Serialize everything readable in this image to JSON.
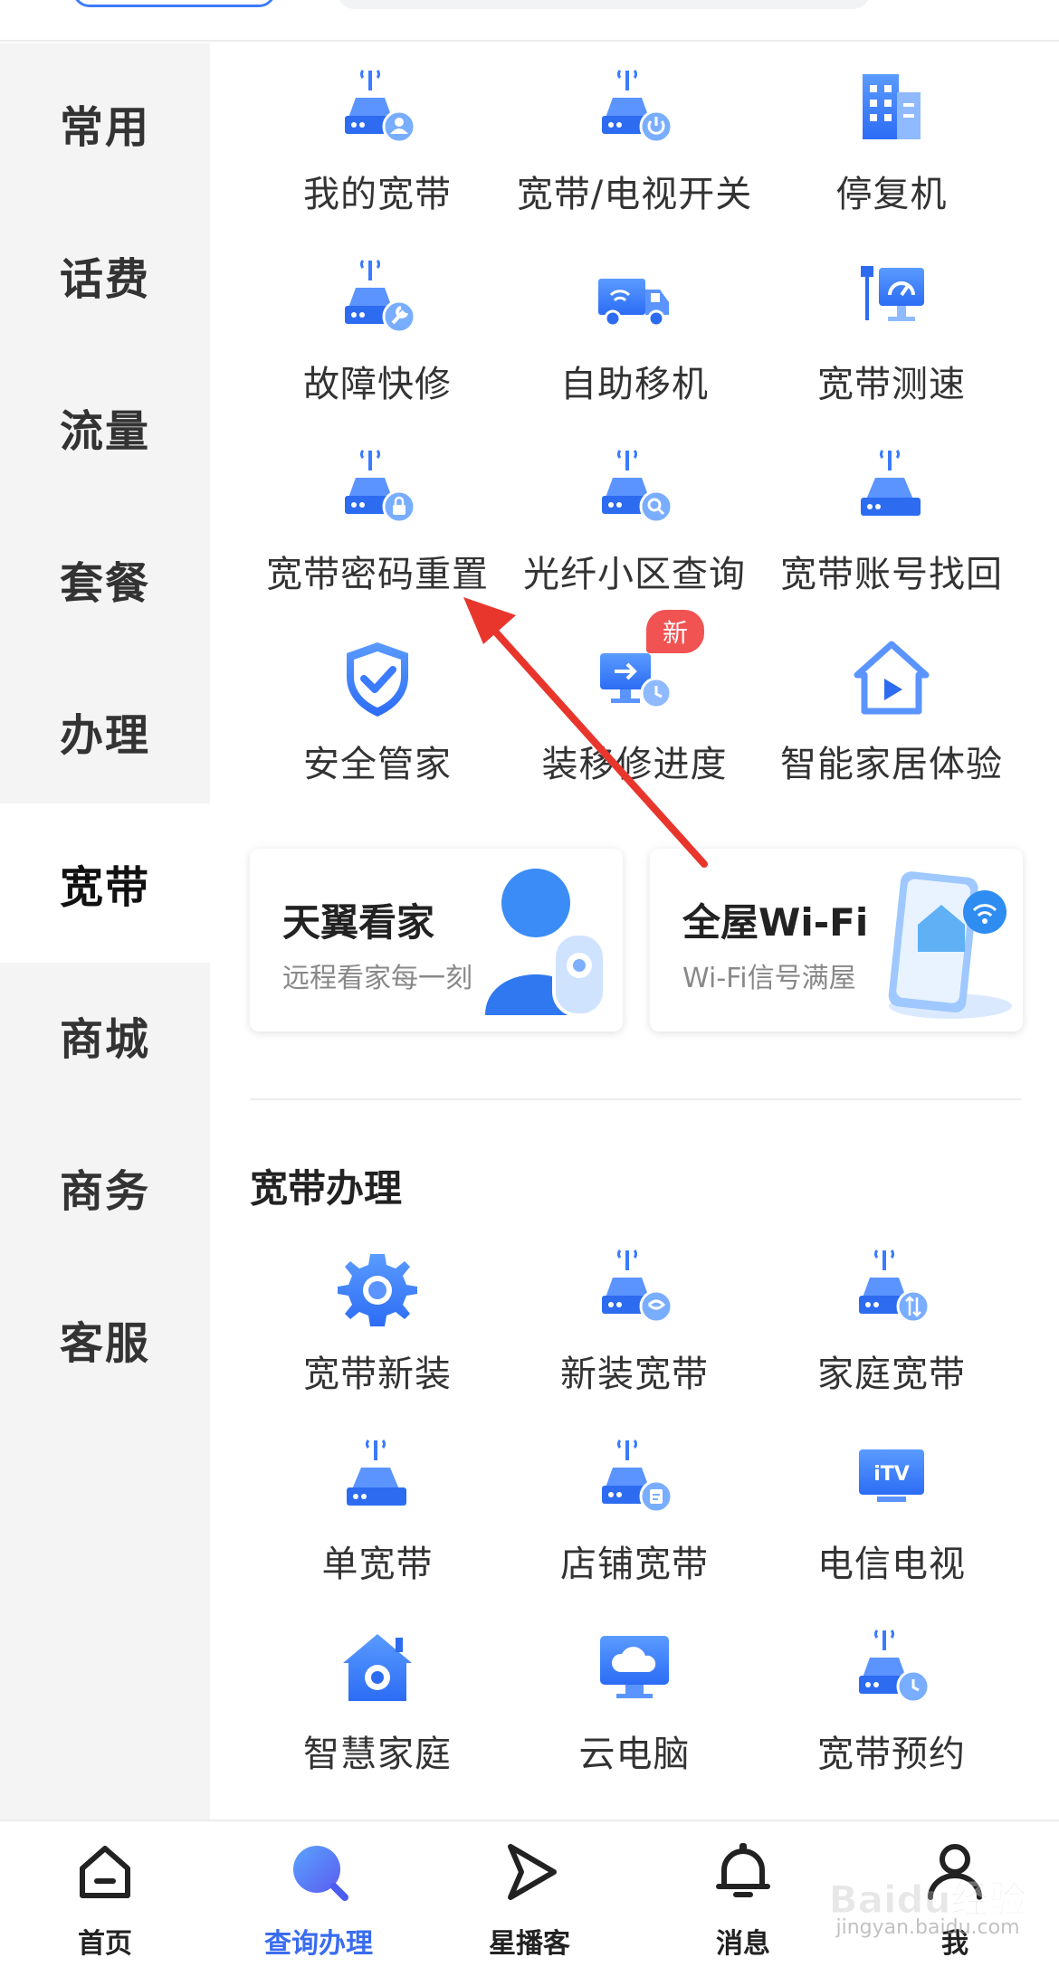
{
  "sidebar": {
    "items": [
      {
        "label": "常用"
      },
      {
        "label": "话费"
      },
      {
        "label": "流量"
      },
      {
        "label": "套餐"
      },
      {
        "label": "办理"
      },
      {
        "label": "宽带"
      },
      {
        "label": "商城"
      },
      {
        "label": "商务"
      },
      {
        "label": "客服"
      }
    ],
    "active": "宽带"
  },
  "services": {
    "items": [
      {
        "label": "我的宽带",
        "icon": "router-user-icon"
      },
      {
        "label": "宽带/电视开关",
        "icon": "router-power-icon"
      },
      {
        "label": "停复机",
        "icon": "building-icon"
      },
      {
        "label": "故障快修",
        "icon": "router-wrench-icon"
      },
      {
        "label": "自助移机",
        "icon": "truck-icon"
      },
      {
        "label": "宽带测速",
        "icon": "speed-test-icon"
      },
      {
        "label": "宽带密码重置",
        "icon": "router-lock-icon"
      },
      {
        "label": "光纤小区查询",
        "icon": "router-search-icon"
      },
      {
        "label": "宽带账号找回",
        "icon": "router-icon"
      },
      {
        "label": "安全管家",
        "icon": "shield-check-icon"
      },
      {
        "label": "装移修进度",
        "icon": "monitor-clock-icon",
        "badge": "新"
      },
      {
        "label": "智能家居体验",
        "icon": "smart-home-play-icon"
      }
    ]
  },
  "promo_cards": [
    {
      "title": "天翼看家",
      "subtitle": "远程看家每一刻",
      "icon": "user-camera-icon"
    },
    {
      "title": "全屋Wi-Fi",
      "subtitle": "Wi-Fi信号满屋",
      "icon": "phone-wifi-icon"
    }
  ],
  "broadband_section": {
    "title": "宽带办理",
    "items": [
      {
        "label": "宽带新装",
        "icon": "gear-icon"
      },
      {
        "label": "新装宽带",
        "icon": "router-telecom-icon"
      },
      {
        "label": "家庭宽带",
        "icon": "router-speed-icon"
      },
      {
        "label": "单宽带",
        "icon": "router-icon"
      },
      {
        "label": "店铺宽带",
        "icon": "router-shop-icon"
      },
      {
        "label": "电信电视",
        "icon": "itv-icon"
      },
      {
        "label": "智慧家庭",
        "icon": "home-camera-icon"
      },
      {
        "label": "云电脑",
        "icon": "cloud-monitor-icon"
      },
      {
        "label": "宽带预约",
        "icon": "router-clock-icon"
      }
    ]
  },
  "bottom_nav": {
    "items": [
      {
        "label": "首页",
        "icon": "home-icon"
      },
      {
        "label": "查询办理",
        "icon": "search-icon",
        "active": true
      },
      {
        "label": "星播客",
        "icon": "play-arrow-icon"
      },
      {
        "label": "消息",
        "icon": "bell-icon"
      },
      {
        "label": "我",
        "icon": "user-icon"
      }
    ]
  },
  "watermark": {
    "text": "Baidu经验",
    "sub": "jingyan.baidu.com"
  },
  "colors": {
    "accent": "#3a7bff",
    "nav_active": "#3a6cf0",
    "badge": "#f15252",
    "arrow": "#e8362c"
  }
}
